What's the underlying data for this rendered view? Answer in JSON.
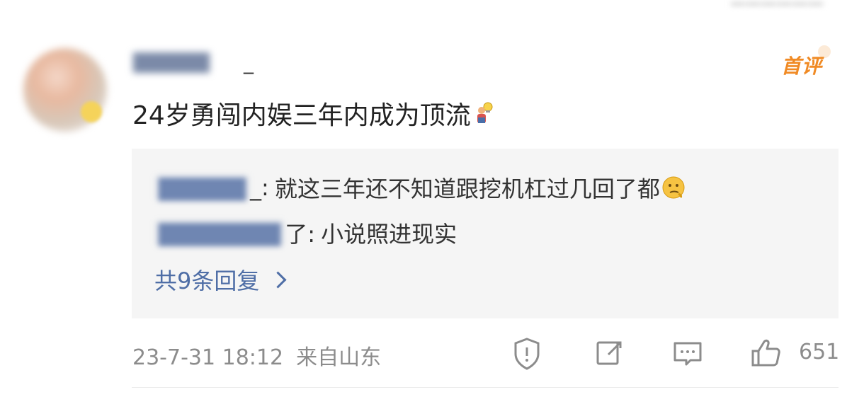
{
  "comment": {
    "username_suffix": "_",
    "first_comment_badge": "首评",
    "text": "24岁勇闯内娱三年内成为顶流",
    "emoji_icon": "person-with-lightbulb-emoji",
    "meta": {
      "time": "23-7-31 18:12",
      "location": "来自山东"
    },
    "likes": "651"
  },
  "replies": [
    {
      "user_suffix": "_:",
      "text": "就这三年还不知道跟挖机杠过几回了都",
      "emoji_icon": "thinking-face-emoji"
    },
    {
      "user_suffix": "了:",
      "text": "小说照进现实"
    }
  ],
  "replies_more_label": "共9条回复",
  "colors": {
    "link_blue": "#4f6ea6",
    "badge_orange": "#f08a24",
    "meta_gray": "#8c8c8c",
    "panel_bg": "#f5f5f5"
  }
}
